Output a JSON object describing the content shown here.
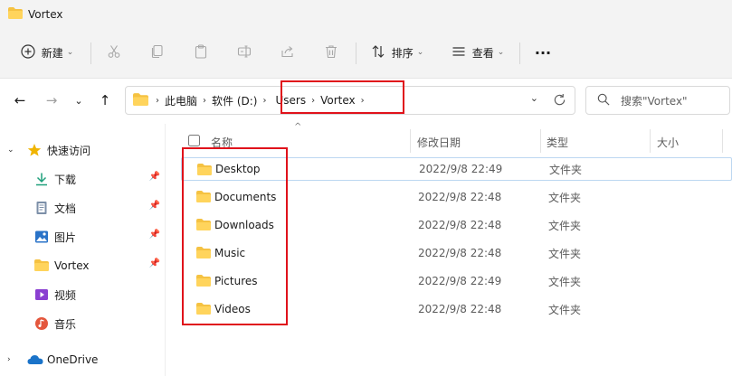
{
  "window": {
    "title": "Vortex"
  },
  "toolbar": {
    "new_label": "新建",
    "sort_label": "排序",
    "view_label": "查看",
    "more_label": "···"
  },
  "nav": {
    "back": "←",
    "forward": "→",
    "recent": "⌄",
    "up": "↑"
  },
  "breadcrumb": {
    "items": [
      "此电脑",
      "软件 (D:)",
      "Users",
      "Vortex"
    ]
  },
  "search": {
    "placeholder": "搜索\"Vortex\""
  },
  "sidebar": {
    "quick_access": "快速访问",
    "items": [
      {
        "label": "下载",
        "icon": "download-icon",
        "pinned": true
      },
      {
        "label": "文档",
        "icon": "document-icon",
        "pinned": true
      },
      {
        "label": "图片",
        "icon": "picture-icon",
        "pinned": true
      },
      {
        "label": "Vortex",
        "icon": "folder-icon",
        "pinned": true
      },
      {
        "label": "视频",
        "icon": "video-icon",
        "pinned": false
      },
      {
        "label": "音乐",
        "icon": "music-icon",
        "pinned": false
      }
    ],
    "onedrive": "OneDrive"
  },
  "columns": {
    "name": "名称",
    "modified": "修改日期",
    "type": "类型",
    "size": "大小"
  },
  "files": [
    {
      "name": "Desktop",
      "modified": "2022/9/8 22:49",
      "type": "文件夹"
    },
    {
      "name": "Documents",
      "modified": "2022/9/8 22:48",
      "type": "文件夹"
    },
    {
      "name": "Downloads",
      "modified": "2022/9/8 22:48",
      "type": "文件夹"
    },
    {
      "name": "Music",
      "modified": "2022/9/8 22:48",
      "type": "文件夹"
    },
    {
      "name": "Pictures",
      "modified": "2022/9/8 22:49",
      "type": "文件夹"
    },
    {
      "name": "Videos",
      "modified": "2022/9/8 22:48",
      "type": "文件夹"
    }
  ],
  "colors": {
    "folder": "#f5c242",
    "highlight": "#e0121b",
    "selection_border": "#bcd7f1",
    "onedrive": "#1a73c9",
    "star": "#f0b400"
  }
}
